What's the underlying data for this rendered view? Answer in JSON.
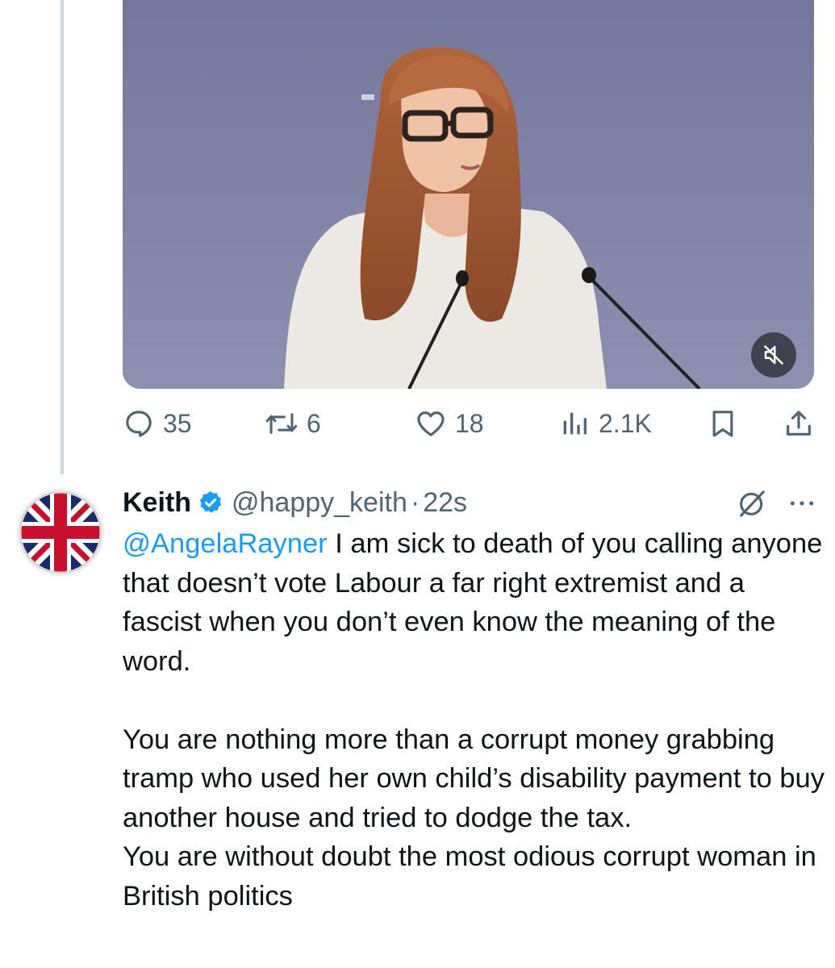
{
  "media": {
    "type": "video",
    "mute_icon": "speaker-muted-icon"
  },
  "actions": {
    "replies": "35",
    "reposts": "6",
    "likes": "18",
    "views": "2.1K",
    "icons": [
      "reply-icon",
      "repost-icon",
      "like-icon",
      "views-icon",
      "bookmark-icon",
      "share-icon"
    ]
  },
  "reply": {
    "avatar": "union-jack-flag-avatar",
    "name": "Keith",
    "verified": true,
    "handle": "@happy_keith",
    "separator": "·",
    "time": "22s",
    "mention": "@AngelaRayner",
    "text_first": " I am sick to death of you calling anyone that doesn’t vote Labour a far right extremist and a fascist when you don’t even know the meaning of the word.",
    "text_second": "You are nothing more than a corrupt money grabbing tramp who used her own child’s disability payment to buy another house and tried to dodge the tax.",
    "text_third": "You are without doubt the most odious corrupt woman in British politics"
  },
  "colors": {
    "accent": "#1d9bf0",
    "secondary_text": "#536471",
    "primary_text": "#0f1419",
    "thread_line": "#cfd9de"
  }
}
